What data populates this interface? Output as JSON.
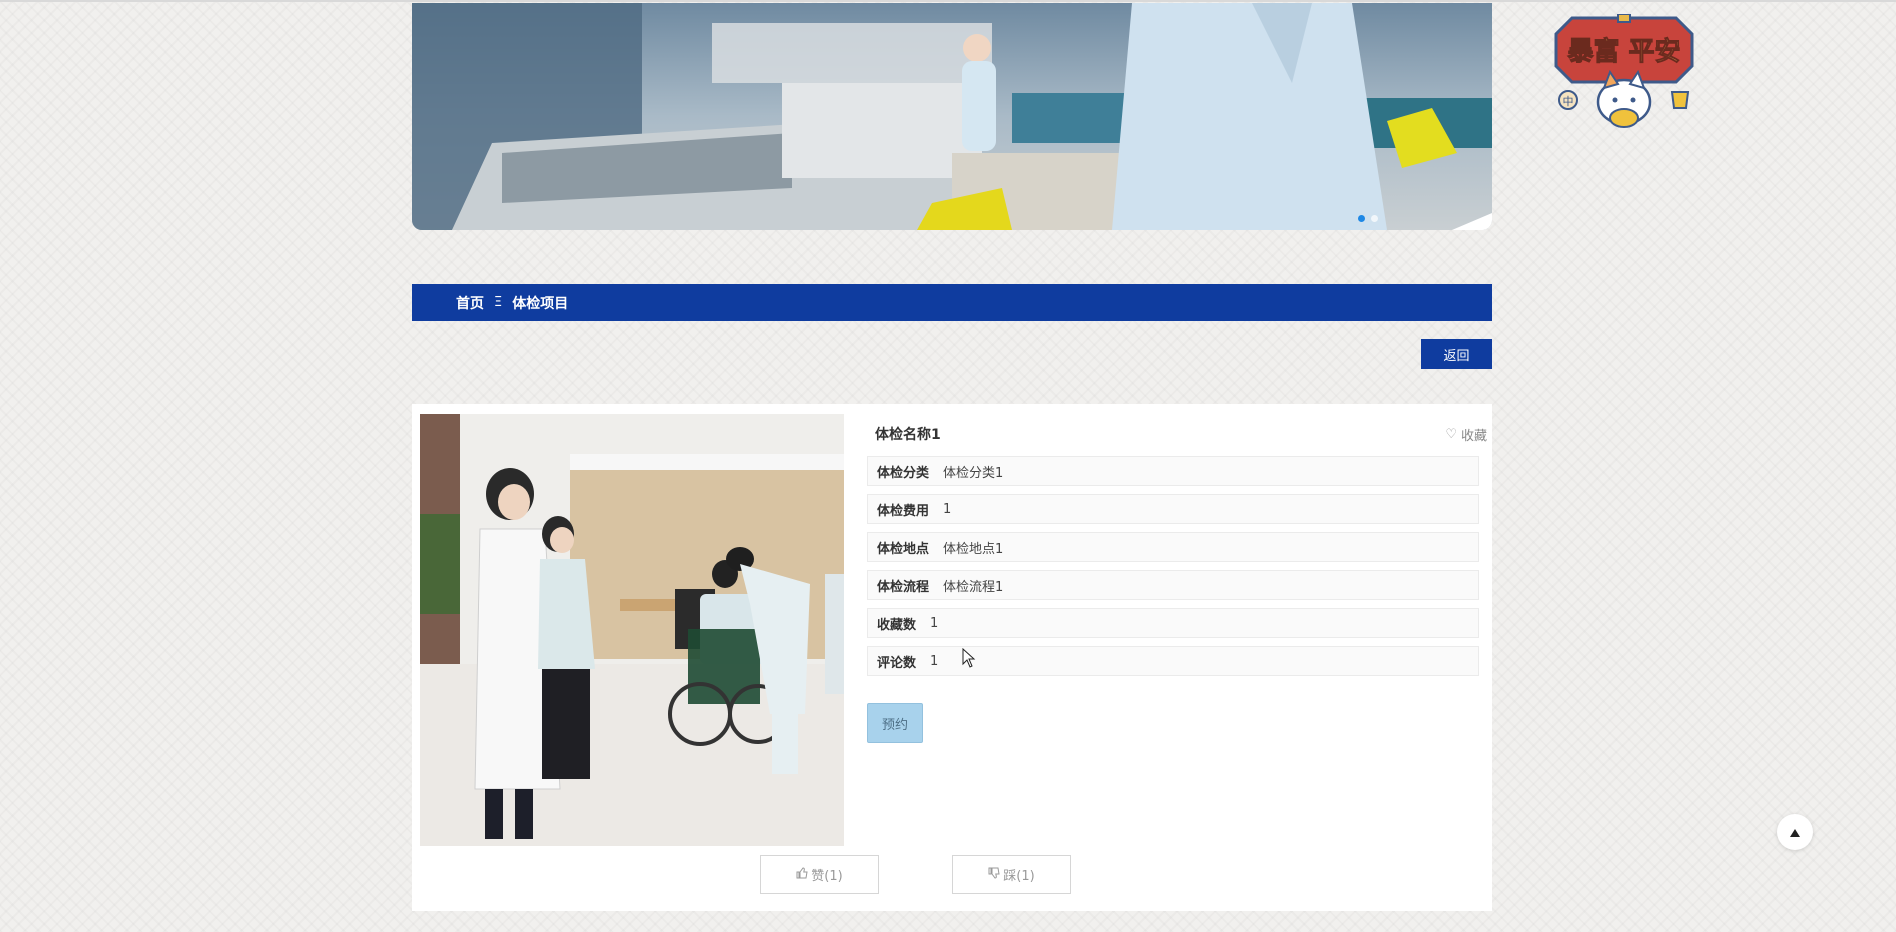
{
  "banner": {
    "slides": 2,
    "active_slide": 1
  },
  "sticker": {
    "text": "暴富平安"
  },
  "breadcrumb": {
    "home": "首页",
    "separator": "Ξ",
    "current": "体检项目"
  },
  "back_label": "返回",
  "detail": {
    "name": "体检名称1",
    "favorite_label": "收藏",
    "fields": [
      {
        "key": "体检分类",
        "value": "体检分类1"
      },
      {
        "key": "体检费用",
        "value": "1"
      },
      {
        "key": "体检地点",
        "value": "体检地点1"
      },
      {
        "key": "体检流程",
        "value": "体检流程1"
      },
      {
        "key": "收藏数",
        "value": "1"
      },
      {
        "key": "评论数",
        "value": "1"
      }
    ],
    "book_label": "预约",
    "like_label": "赞(1)",
    "dislike_label": "踩(1)"
  },
  "colors": {
    "primary": "#0f3c9f",
    "book_button": "#a8d2ec"
  },
  "icons": {
    "favorite": "heart-outline-icon",
    "like": "thumbs-up-icon",
    "dislike": "thumbs-down-icon",
    "scroll_top": "triangle-up-icon"
  }
}
